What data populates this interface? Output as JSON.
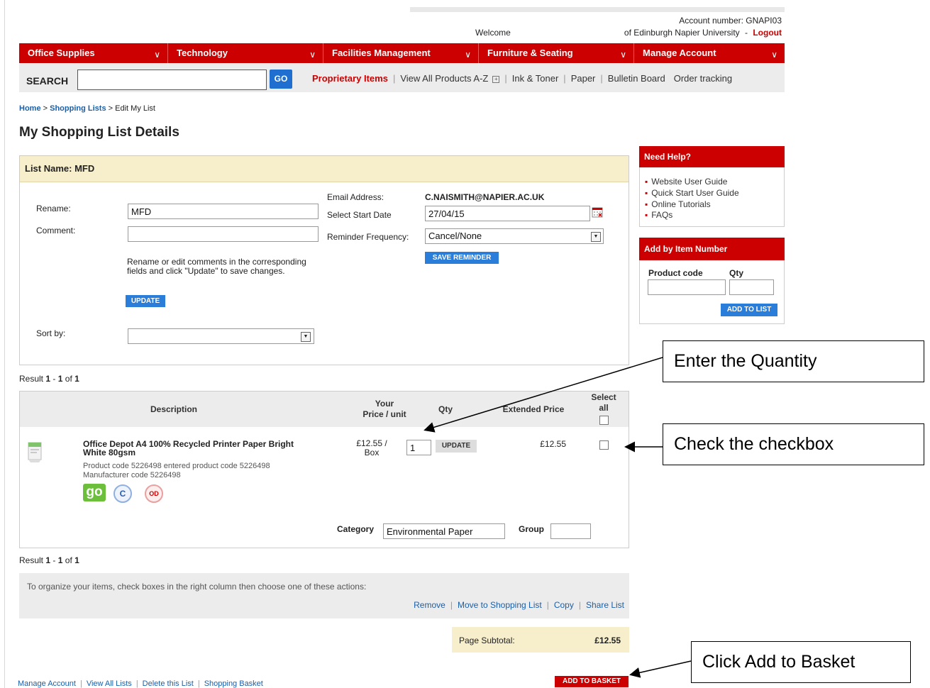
{
  "account": {
    "number": "Account number: GNAPI03",
    "welcome": "Welcome",
    "org": "of Edinburgh Napier University",
    "dash": "-",
    "logout": "Logout"
  },
  "nav": {
    "tabs": [
      "Office Supplies",
      "Technology",
      "Facilities Management",
      "Furniture & Seating",
      "Manage Account"
    ]
  },
  "search": {
    "label": "SEARCH",
    "value": "",
    "go": "GO"
  },
  "toplinks": {
    "proprietary": "Proprietary Items",
    "view_all": "View All Products A-Z",
    "ink": "Ink & Toner",
    "paper": "Paper",
    "bulletin": "Bulletin Board",
    "order": "Order tracking"
  },
  "breadcrumb": {
    "home": "Home",
    "lists": "Shopping Lists",
    "current": "Edit My List",
    "sep": ">"
  },
  "page_title": "My Shopping List Details",
  "list": {
    "header": "List Name: MFD",
    "rename_label": "Rename:",
    "rename_value": "MFD",
    "comment_label": "Comment:",
    "comment_value": "",
    "help_text": "Rename or edit comments in the corresponding fields and click \"Update\" to save changes.",
    "update": "UPDATE",
    "sort_label": "Sort by:",
    "sort_value": "",
    "email_label": "Email Address:",
    "email_value": "C.NAISMITH@NAPIER.AC.UK",
    "start_label": "Select Start Date",
    "start_value": "27/04/15",
    "reminder_label": "Reminder Frequency:",
    "reminder_value": "Cancel/None",
    "save_reminder": "SAVE REMINDER"
  },
  "help": {
    "title": "Need Help?",
    "links": [
      "Website User Guide",
      "Quick Start User Guide",
      "Online Tutorials",
      "FAQs"
    ]
  },
  "add_item": {
    "title": "Add by Item Number",
    "code_label": "Product code",
    "qty_label": "Qty",
    "button": "ADD TO LIST"
  },
  "results": {
    "prefix": "Result",
    "from": "1",
    "dash": "-",
    "to": "1",
    "of": "of",
    "total": "1"
  },
  "table": {
    "col_desc": "Description",
    "col_price_1": "Your",
    "col_price_2": "Price / unit",
    "col_qty": "Qty",
    "col_ext": "Extended Price",
    "col_select_1": "Select",
    "col_select_2": "all"
  },
  "item": {
    "name_1": "Office Depot A4 100% Recycled Printer Paper Bright",
    "name_2": "White 80gsm",
    "codes": "Product code 5226498 entered product code 5226498",
    "mfr": "Manufacturer code 5226498",
    "price_1": "£12.55 /",
    "price_2": "Box",
    "qty": "1",
    "update": "UPDATE",
    "ext_price": "£12.55",
    "badge_go": "go",
    "badge_c": "C",
    "badge_od": "OD",
    "category_label": "Category",
    "category_value": "Environmental Paper",
    "group_label": "Group",
    "group_value": ""
  },
  "actions": {
    "text": "To organize your items, check boxes in the right column then choose one of these actions:",
    "links": [
      "Remove",
      "Move to Shopping List",
      "Copy",
      "Share List"
    ]
  },
  "subtotal": {
    "label": "Page Subtotal:",
    "value": "£12.55"
  },
  "basket_button": "ADD TO BASKET",
  "footer_links": [
    "Manage Account",
    "View All Lists",
    "Delete this List",
    "Shopping Basket"
  ],
  "callouts": {
    "qty": "Enter the Quantity",
    "checkbox": "Check the checkbox",
    "basket": "Click Add to Basket"
  },
  "colors": {
    "brand_red": "#cc0000",
    "link_blue": "#1a5fa8",
    "button_blue": "#2a7dd8",
    "panel_beige": "#f7eecc"
  }
}
